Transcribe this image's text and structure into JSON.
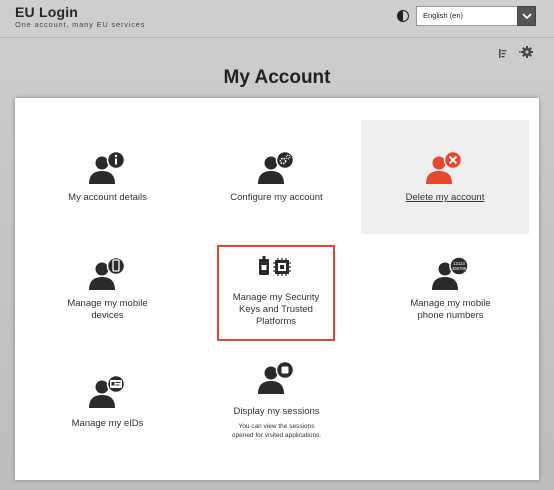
{
  "header": {
    "title": "EU Login",
    "subtitle": "One account, many EU services",
    "language": "English (en)"
  },
  "icons": {
    "contrast": "contrast-icon",
    "language_dropdown": "chevron-down-icon",
    "sort": "sort-icon",
    "settings": "gear-icon"
  },
  "colors": {
    "accent_red": "#e8462f",
    "icon_dark": "#2a2a2a",
    "highlight_bg": "#eeeeee"
  },
  "page": {
    "title": "My Account"
  },
  "tiles": [
    {
      "label": "My account details",
      "icon": "user-info-icon"
    },
    {
      "label": "Configure my account",
      "icon": "user-gear-icon"
    },
    {
      "label": "Delete my account",
      "icon": "user-delete-icon"
    },
    {
      "label": "Manage my mobile devices",
      "icon": "user-mobile-icon"
    },
    {
      "label": "Manage my Security Keys and Trusted Platforms",
      "icon": "security-key-icon"
    },
    {
      "label": "Manage my mobile phone numbers",
      "icon": "user-phone-number-icon",
      "badge": [
        "12123",
        "456789"
      ]
    },
    {
      "label": "Manage my eIDs",
      "icon": "user-eid-icon"
    },
    {
      "label": "Display my sessions",
      "icon": "user-session-icon",
      "note": "You can view the sessions opened for visited applications."
    }
  ]
}
